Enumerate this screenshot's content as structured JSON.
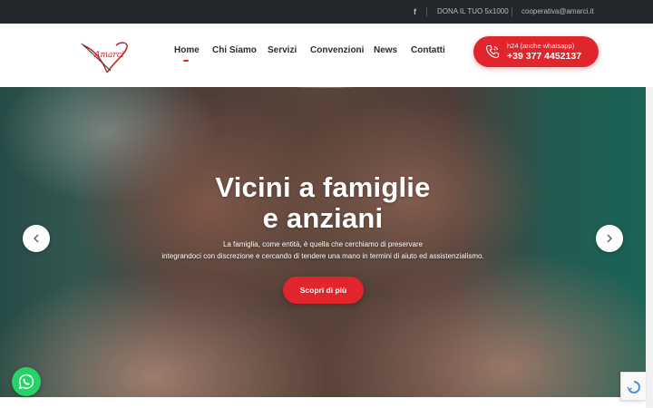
{
  "topbar": {
    "facebook_icon": "facebook-icon",
    "facebook_glyph": "f",
    "donate": "DONA IL TUO 5x1000",
    "email": "cooperativa@amarci.it"
  },
  "logo": {
    "text": "Amarci"
  },
  "nav": {
    "items": [
      {
        "label": "Home",
        "active": true
      },
      {
        "label": "Chi Siamo"
      },
      {
        "label": "Servizi"
      },
      {
        "label": "Convenzioni"
      },
      {
        "label": "News"
      },
      {
        "label": "Contatti"
      }
    ]
  },
  "cta": {
    "icon": "phone-icon",
    "line1": "h24 (anche whatsapp)",
    "line2": "+39 377 4452137"
  },
  "hero": {
    "title_line1": "Vicini a famiglie",
    "title_line2": "e anziani",
    "description_line1": "La famiglia, come entità, è quella che cerchiamo di preservare",
    "description_line2": "integrandoci con discrezione e cercando di tendere una mano in termini di aiuto ed assistenzialismo.",
    "button": "Scopri di più",
    "prev_icon": "chevron-left-icon",
    "next_icon": "chevron-right-icon"
  },
  "whatsapp": {
    "icon": "whatsapp-icon"
  },
  "recaptcha": {
    "icon": "recaptcha-icon"
  },
  "colors": {
    "accent": "#e0262c",
    "topbar": "#23262b",
    "whatsapp": "#25d366"
  }
}
